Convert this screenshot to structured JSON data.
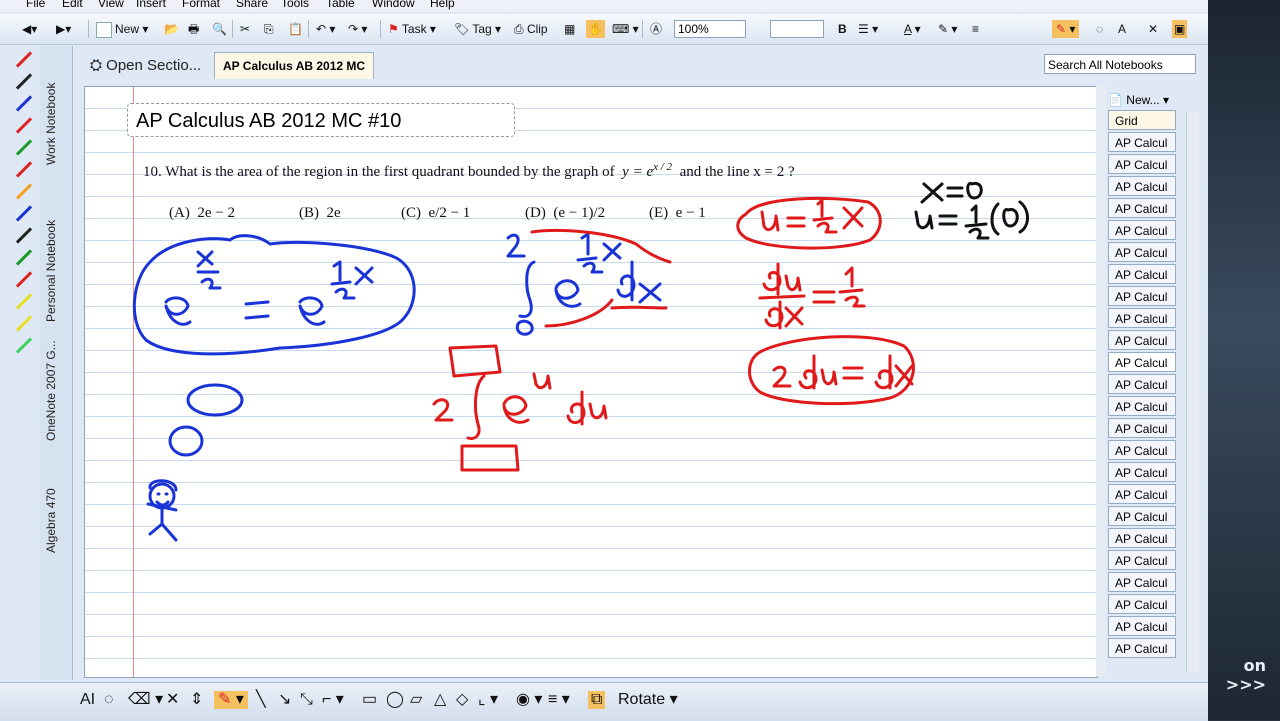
{
  "menu": [
    "File",
    "Edit",
    "View",
    "Insert",
    "Format",
    "Share",
    "Tools",
    "Table",
    "Window",
    "Help"
  ],
  "toolbar": {
    "new_label": "New",
    "task_label": "Task",
    "tag_label": "Tag",
    "clip_label": "Clip",
    "zoom": "100%",
    "bold_label": "B"
  },
  "tabs": {
    "open_sections": "Open Sectio...",
    "active_section": "AP Calculus AB 2012 MC"
  },
  "search": {
    "placeholder": "Search All Notebooks"
  },
  "notebooks": [
    "Work Notebook",
    "Personal Notebook",
    "OneNote 2007 G...",
    "Algebra 470"
  ],
  "page": {
    "title": "AP Calculus AB 2012 MC #10",
    "question": "10.  What is the area of the region in the first quadrant bounded by the graph of",
    "question_eq": "y = e",
    "question_exp": "x / 2",
    "question_tail": "and the line  x = 2 ?",
    "choices": [
      {
        "label": "(A)",
        "text": "2e − 2"
      },
      {
        "label": "(B)",
        "text": "2e"
      },
      {
        "label": "(C)",
        "text": "e/2 − 1"
      },
      {
        "label": "(D)",
        "text": "(e − 1)/2"
      },
      {
        "label": "(E)",
        "text": "e − 1"
      }
    ]
  },
  "right_panel": {
    "new_page": "New...",
    "pages": [
      "Grid",
      "AP Calcul",
      "AP Calcul",
      "AP Calcul",
      "AP Calcul",
      "AP Calcul",
      "AP Calcul",
      "AP Calcul",
      "AP Calcul",
      "AP Calcul",
      "AP Calcul",
      "AP Calcul",
      "AP Calcul",
      "AP Calcul",
      "AP Calcul",
      "AP Calcul",
      "AP Calcul",
      "AP Calcul",
      "AP Calcul",
      "AP Calcul",
      "AP Calcul",
      "AP Calcul",
      "AP Calcul",
      "AP Calcul",
      "AP Calcul"
    ],
    "selected_index": 11
  },
  "bottom_toolbar": {
    "rotate_label": "Rotate"
  },
  "desktop": {
    "brand": "on >>>"
  },
  "colors": {
    "ink_blue": "#1a33d6",
    "ink_red": "#e01a1a",
    "ink_black": "#111111"
  }
}
